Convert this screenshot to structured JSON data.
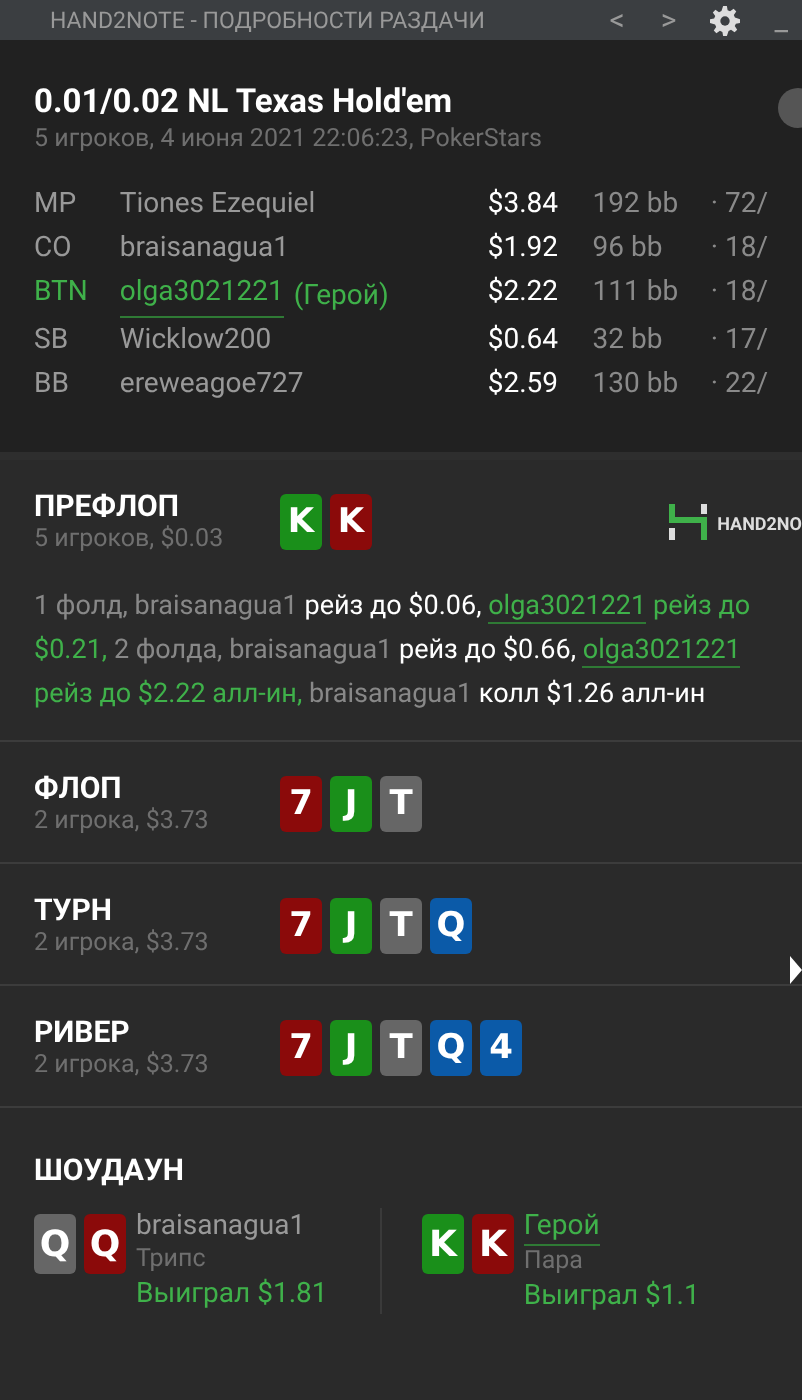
{
  "window": {
    "title": "HAND2NOTE - ПОДРОБНОСТИ РАЗДАЧИ",
    "controls": [
      "<",
      ">",
      "_"
    ]
  },
  "hand": {
    "title": "0.01/0.02 NL Texas Hold'em",
    "subtitle": "5 игроков, 4 июня 2021 22:06:23, PokerStars",
    "players": [
      {
        "position": "MP",
        "name": "Tiones Ezequiel",
        "hero": false,
        "stack": "$3.84",
        "bb": "192 bb",
        "stats": "· 72/"
      },
      {
        "position": "CO",
        "name": "braisanagua1",
        "hero": false,
        "stack": "$1.92",
        "bb": "96 bb",
        "stats": "· 18/"
      },
      {
        "position": "BTN",
        "name": "olga3021221",
        "hero": true,
        "hero_label": "(Герой)",
        "stack": "$2.22",
        "bb": "111 bb",
        "stats": "· 18/"
      },
      {
        "position": "SB",
        "name": "Wicklow200",
        "hero": false,
        "stack": "$0.64",
        "bb": "32 bb",
        "stats": "· 17/"
      },
      {
        "position": "BB",
        "name": "ereweagoe727",
        "hero": false,
        "stack": "$2.59",
        "bb": "130 bb",
        "stats": "· 22/"
      }
    ]
  },
  "streets": [
    {
      "name": "ПРЕФЛОП",
      "info": "5 игроков, $0.03",
      "logo": "HAND2NO",
      "cards": [
        {
          "rank": "K",
          "color": "#1a8f1a"
        },
        {
          "rank": "K",
          "color": "#8b0a0a"
        }
      ],
      "actions": [
        {
          "kind": "player",
          "text": "1 фолд, braisanagua1"
        },
        {
          "kind": "action",
          "text": "рейз до $0.06,"
        },
        {
          "kind": "hero",
          "text": "olga3021221"
        },
        {
          "kind": "hero_action",
          "text": "рейз до $0.21,"
        },
        {
          "kind": "player",
          "text": "2 фолда, braisanagua1"
        },
        {
          "kind": "action",
          "text": "рейз до $0.66,"
        },
        {
          "kind": "hero",
          "text": "olga3021221"
        },
        {
          "kind": "hero_action",
          "text": "рейз до $2.22 алл-ин,"
        },
        {
          "kind": "player",
          "text": "braisanagua1"
        },
        {
          "kind": "action",
          "text": "колл $1.26 алл-ин"
        }
      ]
    },
    {
      "name": "ФЛОП",
      "info": "2 игрока, $3.73",
      "cards": [
        {
          "rank": "7",
          "color": "#8b0a0a"
        },
        {
          "rank": "J",
          "color": "#1a8f1a"
        },
        {
          "rank": "T",
          "color": "#666666"
        }
      ]
    },
    {
      "name": "ТУРН",
      "info": "2 игрока, $3.73",
      "cards": [
        {
          "rank": "7",
          "color": "#8b0a0a"
        },
        {
          "rank": "J",
          "color": "#1a8f1a"
        },
        {
          "rank": "T",
          "color": "#666666"
        },
        {
          "rank": "Q",
          "color": "#0b5aa8"
        }
      ]
    },
    {
      "name": "РИВЕР",
      "info": "2 игрока, $3.73",
      "cards": [
        {
          "rank": "7",
          "color": "#8b0a0a"
        },
        {
          "rank": "J",
          "color": "#1a8f1a"
        },
        {
          "rank": "T",
          "color": "#666666"
        },
        {
          "rank": "Q",
          "color": "#0b5aa8"
        },
        {
          "rank": "4",
          "color": "#0b5aa8"
        }
      ]
    }
  ],
  "showdown": {
    "title": "ШОУДАУН",
    "hands": [
      {
        "cards": [
          {
            "rank": "Q",
            "color": "#666666"
          },
          {
            "rank": "Q",
            "color": "#8b0a0a"
          }
        ],
        "player": "braisanagua1",
        "hero": false,
        "combo": "Трипс",
        "result": "Выиграл $1.81"
      },
      {
        "cards": [
          {
            "rank": "K",
            "color": "#1a8f1a"
          },
          {
            "rank": "K",
            "color": "#8b0a0a"
          }
        ],
        "player": "Герой",
        "hero": true,
        "combo": "Пара",
        "result": "Выиграл $1.1"
      }
    ]
  }
}
